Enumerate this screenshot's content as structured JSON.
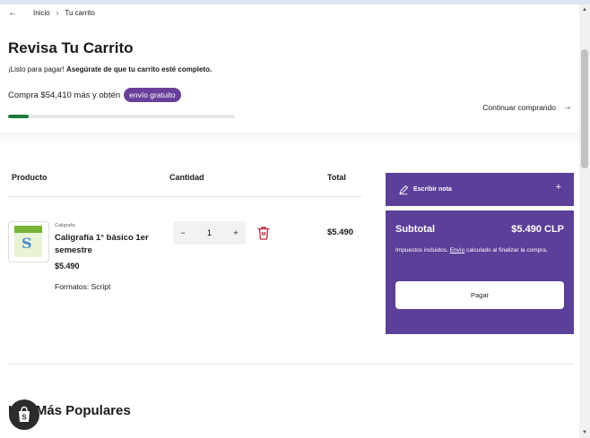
{
  "breadcrumb": {
    "home": "Inicio",
    "separator": "›",
    "current": "Tu carrito"
  },
  "page": {
    "title": "Revisa Tu Carrito"
  },
  "ready": {
    "prefix": "¡Listo para pagar!",
    "emphasis": "Asegúrate de que tu carrito esté completo."
  },
  "shipping": {
    "text": "Compra $54,410 más y obtén",
    "badge": "envío gratuito",
    "progress_percent": 9
  },
  "continue": {
    "label": "Continuar comprando"
  },
  "table": {
    "product": "Producto",
    "quantity": "Cantidad",
    "total": "Total"
  },
  "item": {
    "vendor": "Caligrafix",
    "name": "Caligrafía 1° básico 1er semestre",
    "price": "$5.490",
    "format_label": "Formatos:",
    "format_value": "Script",
    "quantity": "1",
    "minus": "−",
    "plus": "+",
    "line_total": "$5.490"
  },
  "note": {
    "label": "Escribir nota",
    "plus": "+"
  },
  "summary": {
    "title": "Subtotal",
    "amount": "$5.490 CLP",
    "taxes_pre": "Impuestos incluidos.",
    "taxes_link": "Envío",
    "taxes_post": "calculado al finalizar la compra.",
    "pay": "Pagar"
  },
  "popular": {
    "title": "Los Más Populares"
  },
  "colors": {
    "purple": "#5b3f99",
    "badge": "#6a3f9b",
    "progress": "#1e7a3c",
    "trash": "#c0253c"
  },
  "icons": [
    "arrow-left-icon",
    "arrow-right-icon",
    "pencil-icon",
    "trash-icon",
    "shopify-bag-icon",
    "scroll-up-icon",
    "scroll-down-icon"
  ]
}
